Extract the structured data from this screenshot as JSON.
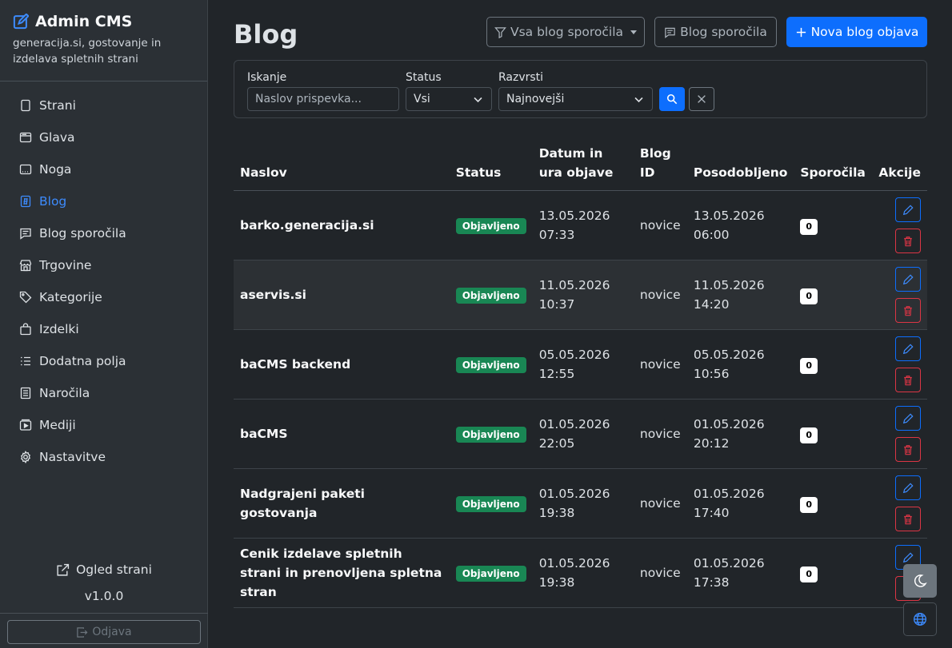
{
  "brand": {
    "title": "Admin CMS",
    "subtitle": "generacija.si, gostovanje in izdelava spletnih strani"
  },
  "sidebar": {
    "items": [
      {
        "label": "Strani",
        "icon": "file-icon",
        "active": false
      },
      {
        "label": "Glava",
        "icon": "window-icon",
        "active": false
      },
      {
        "label": "Noga",
        "icon": "footer-icon",
        "active": false
      },
      {
        "label": "Blog",
        "icon": "blog-icon",
        "active": true
      },
      {
        "label": "Blog sporočila",
        "icon": "message-icon",
        "active": false
      },
      {
        "label": "Trgovine",
        "icon": "shop-icon",
        "active": false
      },
      {
        "label": "Kategorije",
        "icon": "tag-icon",
        "active": false
      },
      {
        "label": "Izdelki",
        "icon": "bag-icon",
        "active": false
      },
      {
        "label": "Dodatna polja",
        "icon": "list-icon",
        "active": false
      },
      {
        "label": "Naročila",
        "icon": "receipt-icon",
        "active": false
      },
      {
        "label": "Mediji",
        "icon": "media-icon",
        "active": false
      },
      {
        "label": "Nastavitve",
        "icon": "gear-icon",
        "active": false
      }
    ],
    "view_site": "Ogled strani",
    "version": "v1.0.0",
    "logout": "Odjava"
  },
  "header": {
    "title": "Blog",
    "filter_dropdown": "Vsa blog sporočila",
    "messages_button": "Blog sporočila",
    "new_button": "Nova blog objava"
  },
  "filters": {
    "search_label": "Iskanje",
    "search_placeholder": "Naslov prispevka...",
    "status_label": "Status",
    "status_value": "Vsi",
    "sort_label": "Razvrsti",
    "sort_value": "Najnovejši"
  },
  "table": {
    "headers": {
      "title": "Naslov",
      "status": "Status",
      "published": "Datum in ura objave",
      "blog_id": "Blog ID",
      "updated": "Posodobljeno",
      "messages": "Sporočila",
      "actions": "Akcije"
    },
    "rows": [
      {
        "title": "barko.generacija.si",
        "status": "Objavljeno",
        "pub_date": "13.05.2026",
        "pub_time": "07:33",
        "blog_id": "novice",
        "upd_date": "13.05.2026",
        "upd_time": "06:00",
        "messages": "0"
      },
      {
        "title": "aservis.si",
        "status": "Objavljeno",
        "pub_date": "11.05.2026",
        "pub_time": "10:37",
        "blog_id": "novice",
        "upd_date": "11.05.2026",
        "upd_time": "14:20",
        "messages": "0"
      },
      {
        "title": "baCMS backend",
        "status": "Objavljeno",
        "pub_date": "05.05.2026",
        "pub_time": "12:55",
        "blog_id": "novice",
        "upd_date": "05.05.2026",
        "upd_time": "10:56",
        "messages": "0"
      },
      {
        "title": "baCMS",
        "status": "Objavljeno",
        "pub_date": "01.05.2026",
        "pub_time": "22:05",
        "blog_id": "novice",
        "upd_date": "01.05.2026",
        "upd_time": "20:12",
        "messages": "0"
      },
      {
        "title": "Nadgrajeni paketi gostovanja",
        "status": "Objavljeno",
        "pub_date": "01.05.2026",
        "pub_time": "19:38",
        "blog_id": "novice",
        "upd_date": "01.05.2026",
        "upd_time": "17:40",
        "messages": "0"
      },
      {
        "title": "Cenik izdelave spletnih strani in prenovljena spletna stran",
        "status": "Objavljeno",
        "pub_date": "01.05.2026",
        "pub_time": "19:38",
        "blog_id": "novice",
        "upd_date": "01.05.2026",
        "upd_time": "17:38",
        "messages": "0"
      }
    ]
  },
  "colors": {
    "accent": "#0d6efd",
    "success": "#198754",
    "danger": "#dc3545",
    "background": "#212529",
    "sidebar": "#2b3035"
  }
}
